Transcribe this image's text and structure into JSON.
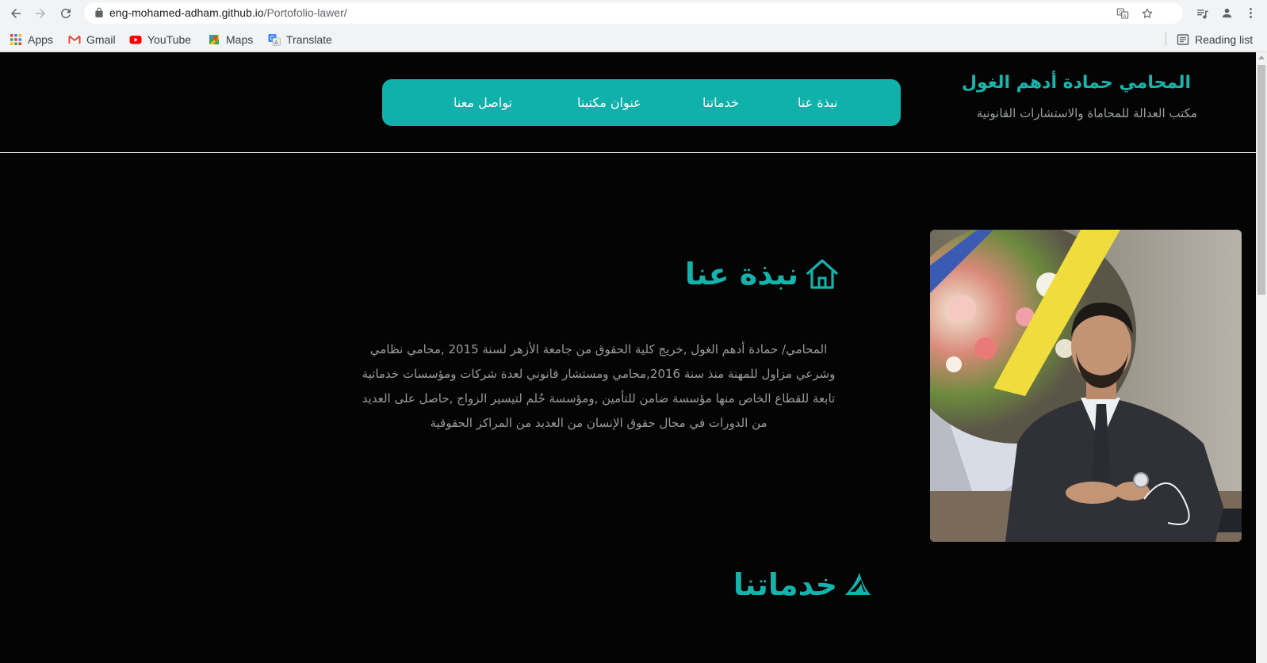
{
  "browser": {
    "url_host": "eng-mohamed-adham.github.io",
    "url_path": "/Portofolio-lawer/",
    "bookmarks": [
      {
        "label": "Apps",
        "icon": "apps-grid-icon"
      },
      {
        "label": "Gmail",
        "icon": "gmail-icon"
      },
      {
        "label": "YouTube",
        "icon": "youtube-icon"
      },
      {
        "label": "Maps",
        "icon": "maps-icon"
      },
      {
        "label": "Translate",
        "icon": "translate-icon"
      }
    ],
    "reading_list_label": "Reading list"
  },
  "site": {
    "title": "المحامي حمادة أدهم الغول",
    "subtitle": "مكتب العدالة للمحاماة والاستشارات القانونية",
    "nav": [
      {
        "label": "نبذة عنا"
      },
      {
        "label": "خدماتنا"
      },
      {
        "label": "عنوان مكتبنا"
      },
      {
        "label": "تواصل معنا"
      }
    ]
  },
  "about": {
    "heading": "نبذة عنا",
    "paragraph": "المحامي/ حمادة أدهم الغول ,خريج كلية الحقوق من جامعة الأزهر لسنة 2015 ,محامي نظامي وشرعي مزاول للمهنة منذ سنة 2016,محامي ومستشار قانوني لعدة شركات ومؤسسات خدماتية تابعة للقطاع الخاص منها مؤسسة ضامن للتأمين ,ومؤسسة حُلم لتيسير الزواج ,حاصل على العديد من الدورات في مجال حقوق الإنسان من العديد من المراكز الحقوقية"
  },
  "services": {
    "heading": "خدماتنا"
  },
  "colors": {
    "accent": "#11b1ab",
    "background": "#040404",
    "muted_text": "#9a9a9a"
  }
}
